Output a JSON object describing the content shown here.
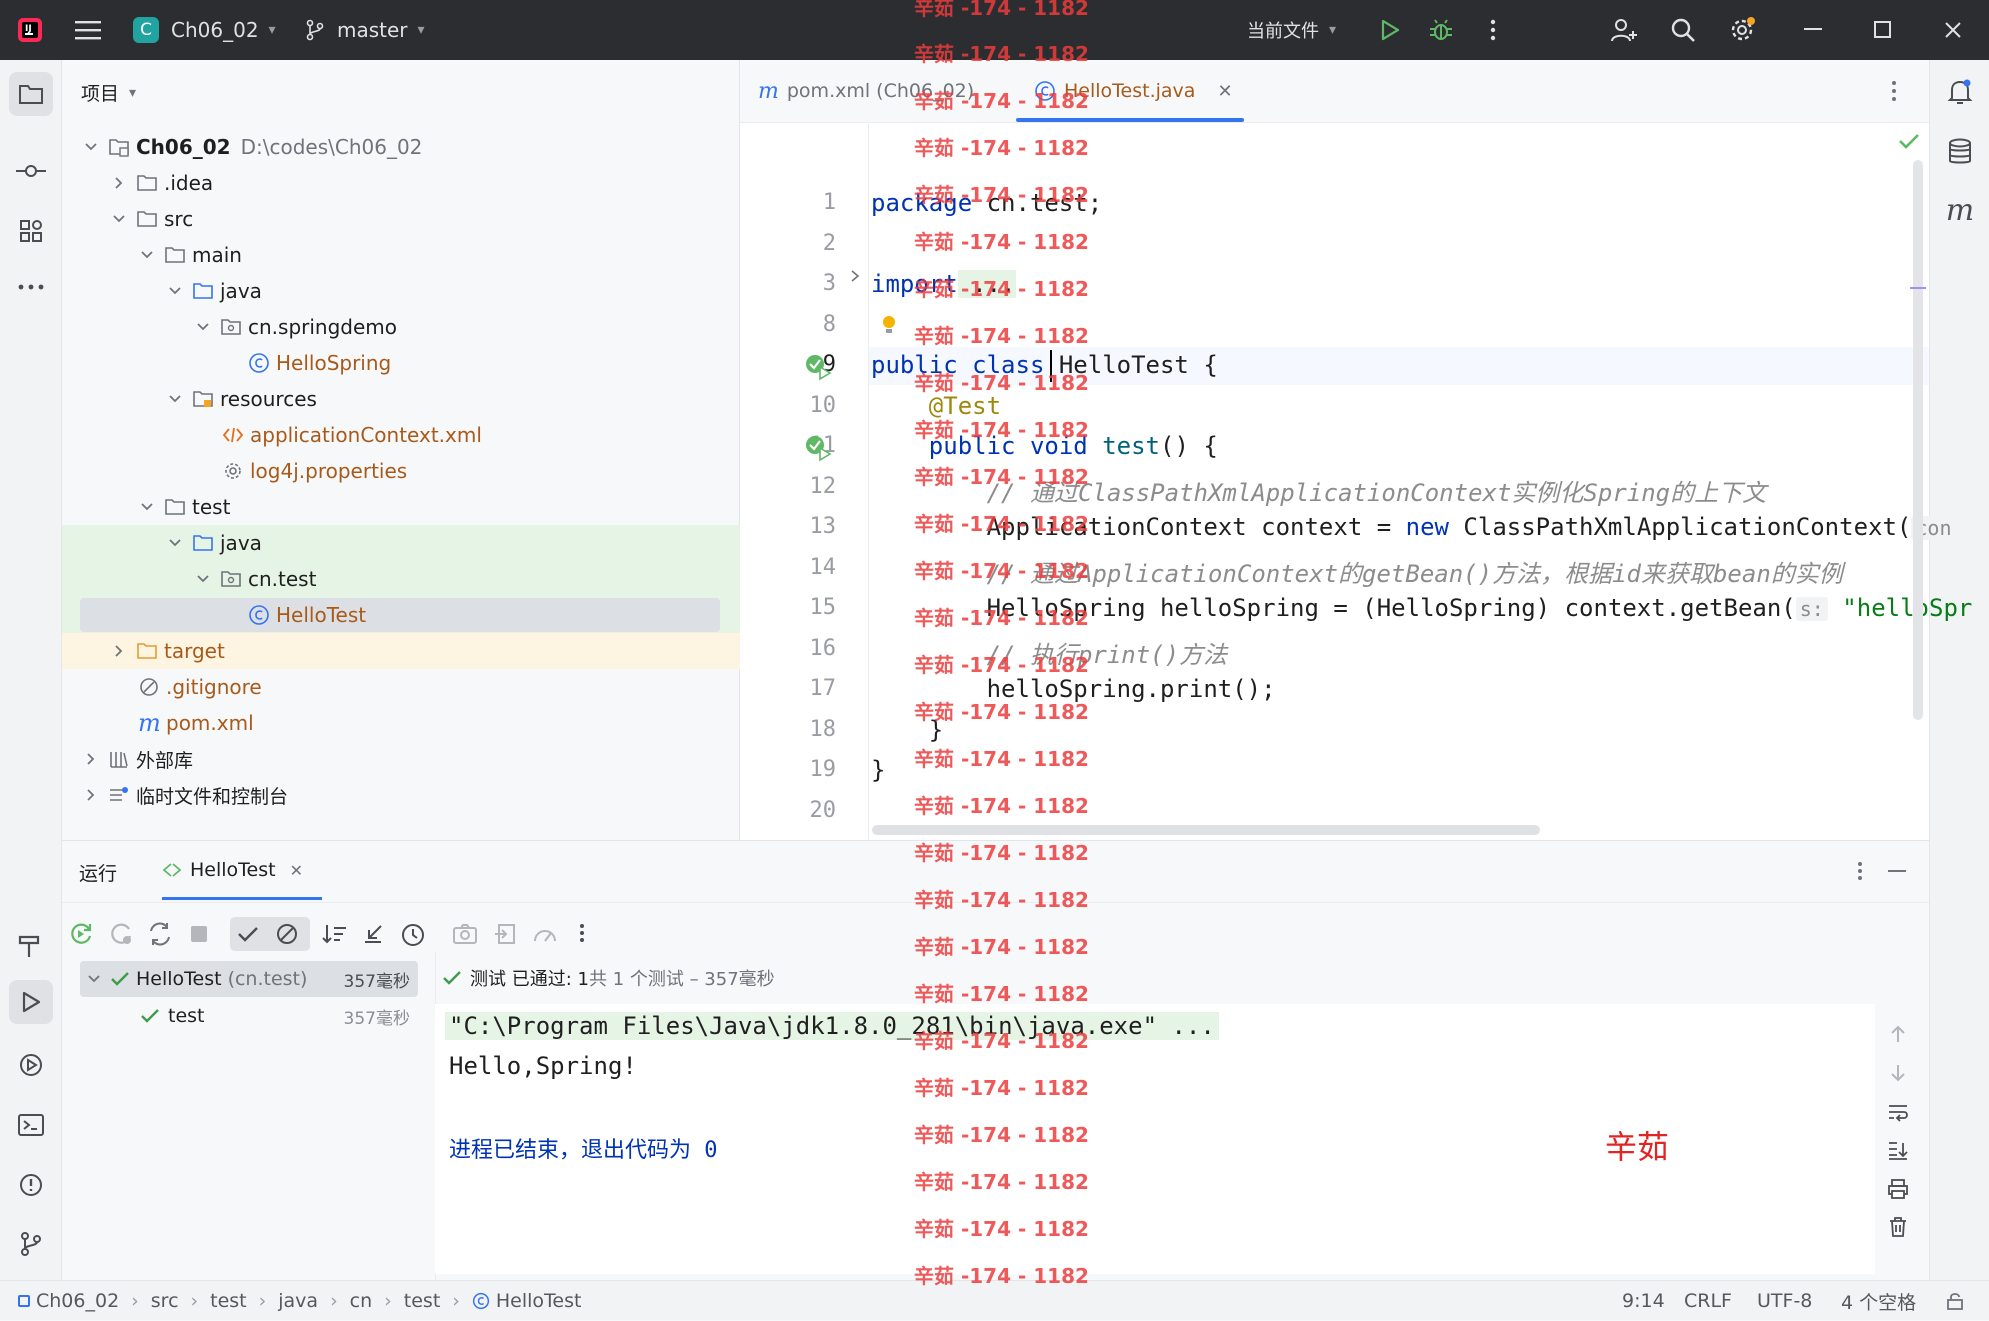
{
  "topbar": {
    "project_name": "Ch06_02",
    "project_badge": "C",
    "branch": "master",
    "run_config": "当前文件"
  },
  "project_panel": {
    "title": "项目",
    "tree": [
      {
        "label": "Ch06_02",
        "path": "D:\\codes\\Ch06_02",
        "icon": "project-folder-icon"
      },
      {
        "label": ".idea",
        "icon": "folder-icon"
      },
      {
        "label": "src",
        "icon": "folder-icon"
      },
      {
        "label": "main",
        "icon": "folder-icon"
      },
      {
        "label": "java",
        "icon": "source-folder-icon"
      },
      {
        "label": "cn.springdemo",
        "icon": "package-icon"
      },
      {
        "label": "HelloSpring",
        "icon": "class-icon"
      },
      {
        "label": "resources",
        "icon": "resources-folder-icon"
      },
      {
        "label": "applicationContext.xml",
        "icon": "xml-icon"
      },
      {
        "label": "log4j.properties",
        "icon": "properties-icon"
      },
      {
        "label": "test",
        "icon": "folder-icon"
      },
      {
        "label": "java",
        "icon": "test-source-folder-icon"
      },
      {
        "label": "cn.test",
        "icon": "package-icon"
      },
      {
        "label": "HelloTest",
        "icon": "class-icon"
      },
      {
        "label": "target",
        "icon": "excluded-folder-icon"
      },
      {
        "label": ".gitignore",
        "icon": "ignore-file-icon"
      },
      {
        "label": "pom.xml",
        "icon": "maven-icon"
      },
      {
        "label": "外部库",
        "icon": "library-icon"
      },
      {
        "label": "临时文件和控制台",
        "icon": "scratch-icon"
      }
    ]
  },
  "editor": {
    "tabs": [
      {
        "label": "pom.xml (Ch06_02)",
        "icon": "maven-icon",
        "active": false
      },
      {
        "label": "HelloTest.java",
        "icon": "class-icon",
        "active": true
      }
    ],
    "line_numbers": [
      "1",
      "2",
      "3",
      "8",
      "9",
      "10",
      "11",
      "12",
      "13",
      "14",
      "15",
      "16",
      "17",
      "18",
      "19",
      "20"
    ],
    "code": {
      "l1_kw": "package",
      "l1_rest": " cn.test;",
      "l3_kw": "import",
      "l3_rest": " ...",
      "l9_kw": "public class",
      "l9_rest": " HelloTest {",
      "l10": "    @Test",
      "l11_pre": "    ",
      "l11_kw": "public void",
      "l11_fn": " test",
      "l11_rest": "() {",
      "l12": "        // 通过ClassPathXmlApplicationContext实例化Spring的上下文",
      "l13_pre": "        ApplicationContext context = ",
      "l13_kw": "new",
      "l13_rest": " ClassPathXmlApplicationContext(",
      "l13_hint": "con",
      "l14": "        // 通过ApplicationContext的getBean()方法，根据id来获取bean的实例",
      "l15_pre": "        HelloSpring helloSpring = (HelloSpring) context.getBean(",
      "l15_hint": "s:",
      "l15_str": " \"helloSpr",
      "l16": "        // 执行print()方法",
      "l17": "        helloSpring.print();",
      "l18": "    }",
      "l19": "}",
      "l20": ""
    }
  },
  "run_panel": {
    "title": "运行",
    "tab": "HelloTest",
    "tree": [
      {
        "label": "HelloTest",
        "sub": "(cn.test)",
        "time": "357毫秒"
      },
      {
        "label": "test",
        "time": "357毫秒"
      }
    ],
    "summary_prefix": "测试 已通过: 1",
    "summary_suffix": "共 1 个测试 – 357毫秒",
    "console": {
      "cmd": "\"C:\\Program Files\\Java\\jdk1.8.0_281\\bin\\java.exe\" ...",
      "out": "Hello,Spring!",
      "exit": "进程已结束，退出代码为 0"
    },
    "red_label": "辛茹"
  },
  "statusbar": {
    "breadcrumb": [
      "Ch06_02",
      "src",
      "test",
      "java",
      "cn",
      "test",
      "HelloTest"
    ],
    "position": "9:14",
    "line_sep": "CRLF",
    "encoding": "UTF-8",
    "indent": "4 个空格"
  },
  "watermark": "辛茹 -174 - 1182",
  "colors": {
    "topbar_bg": "#2b2d30",
    "accent": "#3574f0",
    "run_green": "#4caf50",
    "selection": "#dcdfe4",
    "test_bg": "#e6f4e6"
  }
}
